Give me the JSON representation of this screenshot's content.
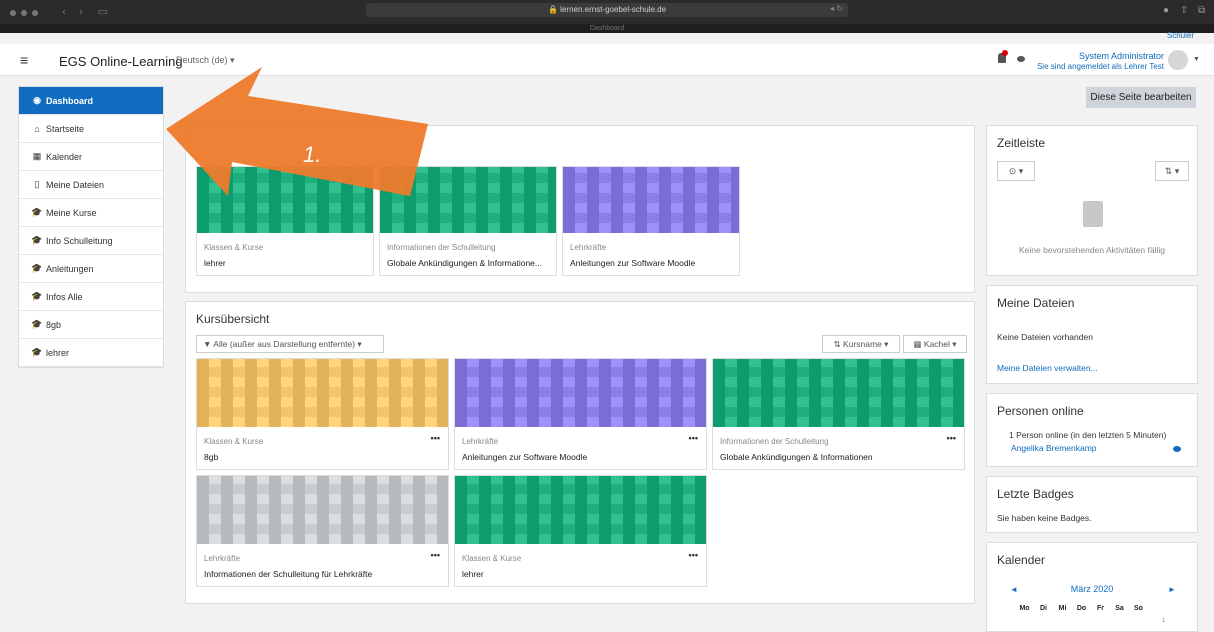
{
  "browser": {
    "url": "lernen.ernst-goebel-schule.de",
    "tab_title": "Dashboard"
  },
  "navbar": {
    "brand": "EGS Online-Learning",
    "language": "Deutsch (de) ▾",
    "user_name": "System Administrator",
    "user_role": "Sie sind angemeldet als Lehrer Test",
    "user_role_extra": "Schüler"
  },
  "edit_button": "Diese Seite bearbeiten",
  "sidebar": {
    "items": [
      {
        "label": "Dashboard",
        "icon": "tachometer-icon",
        "glyph": "◉"
      },
      {
        "label": "Startseite",
        "icon": "home-icon",
        "glyph": "⌂"
      },
      {
        "label": "Kalender",
        "icon": "calendar-icon",
        "glyph": "▦"
      },
      {
        "label": "Meine Dateien",
        "icon": "file-icon",
        "glyph": "▯"
      },
      {
        "label": "Meine Kurse",
        "icon": "graduation-cap-icon",
        "glyph": "🎓"
      },
      {
        "label": "Info Schulleitung",
        "icon": "graduation-cap-icon",
        "glyph": "🎓"
      },
      {
        "label": "Anleitungen",
        "icon": "graduation-cap-icon",
        "glyph": "🎓"
      },
      {
        "label": "Infos Alle",
        "icon": "graduation-cap-icon",
        "glyph": "🎓"
      },
      {
        "label": "8gb",
        "icon": "graduation-cap-icon",
        "glyph": "🎓"
      },
      {
        "label": "lehrer",
        "icon": "graduation-cap-icon",
        "glyph": "🎓"
      }
    ]
  },
  "annotation": {
    "label": "1."
  },
  "recent": {
    "cards": [
      {
        "category": "Klassen & Kurse",
        "name": "lehrer",
        "color": "#1fae7e"
      },
      {
        "category": "Informationen der Schulleitung",
        "name": "Globale Ankündigungen & Informatione...",
        "color": "#1fae7e"
      },
      {
        "category": "Lehrkräfte",
        "name": "Anleitungen zur Software Moodle",
        "color": "#8c7fe8"
      }
    ]
  },
  "overview": {
    "title": "Kursübersicht",
    "filter": "▼ Alle (außer aus Darstellung entfernte) ▾",
    "sort": "Kursname ▾",
    "view": "Kachel ▾",
    "menu_glyph": "•••",
    "cards": [
      {
        "category": "Klassen & Kurse",
        "name": "8gb",
        "color": "#f3c46a"
      },
      {
        "category": "Lehrkräfte",
        "name": "Anleitungen zur Software Moodle",
        "color": "#8c7fe8"
      },
      {
        "category": "Informationen der Schulleitung",
        "name": "Globale Ankündigungen & Informationen",
        "color": "#1fae7e"
      },
      {
        "category": "Lehrkräfte",
        "name": "Informationen der Schulleitung für Lehrkräfte",
        "color": "#c8ccce"
      },
      {
        "category": "Klassen & Kurse",
        "name": "lehrer",
        "color": "#1fae7e"
      }
    ]
  },
  "timeline": {
    "title": "Zeitleiste",
    "empty": "Keine bevorstehenden Aktivitäten fällig",
    "clock_btn": "⊙ ▾",
    "sort_btn": "⇅ ▾"
  },
  "files": {
    "title": "Meine Dateien",
    "empty": "Keine Dateien vorhanden",
    "link": "Meine Dateien verwalten..."
  },
  "online": {
    "title": "Personen online",
    "summary": "1 Person online (in den letzten 5 Minuten)",
    "person": "Angelika Bremenkamp"
  },
  "badges": {
    "title": "Letzte Badges",
    "empty": "Sie haben keine Badges."
  },
  "calendar": {
    "title": "Kalender",
    "month": "März 2020",
    "prev": "◄",
    "next": "►",
    "days": [
      "Mo",
      "Di",
      "Mi",
      "Do",
      "Fr",
      "Sa",
      "So"
    ],
    "first_day": "1"
  },
  "colors": {
    "primary": "#0f6cbf",
    "annotation_arrow": "#ee7a2c"
  }
}
